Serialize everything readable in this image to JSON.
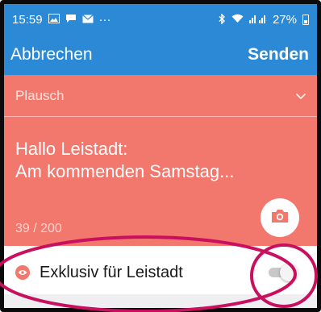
{
  "status_bar": {
    "time": "15:59",
    "notification_dots": "···",
    "battery": "27%"
  },
  "header": {
    "cancel_label": "Abbrechen",
    "send_label": "Senden"
  },
  "composer": {
    "category": "Plausch",
    "message": "Hallo Leistadt:\nAm kommenden Samstag...",
    "char_count": "39 / 200"
  },
  "exclusive": {
    "label": "Exklusiv für Leistadt",
    "toggle_on": false
  },
  "colors": {
    "header_blue": "#2b89d6",
    "composer_red": "#f2776c",
    "annotation_magenta": "#c8105f"
  }
}
